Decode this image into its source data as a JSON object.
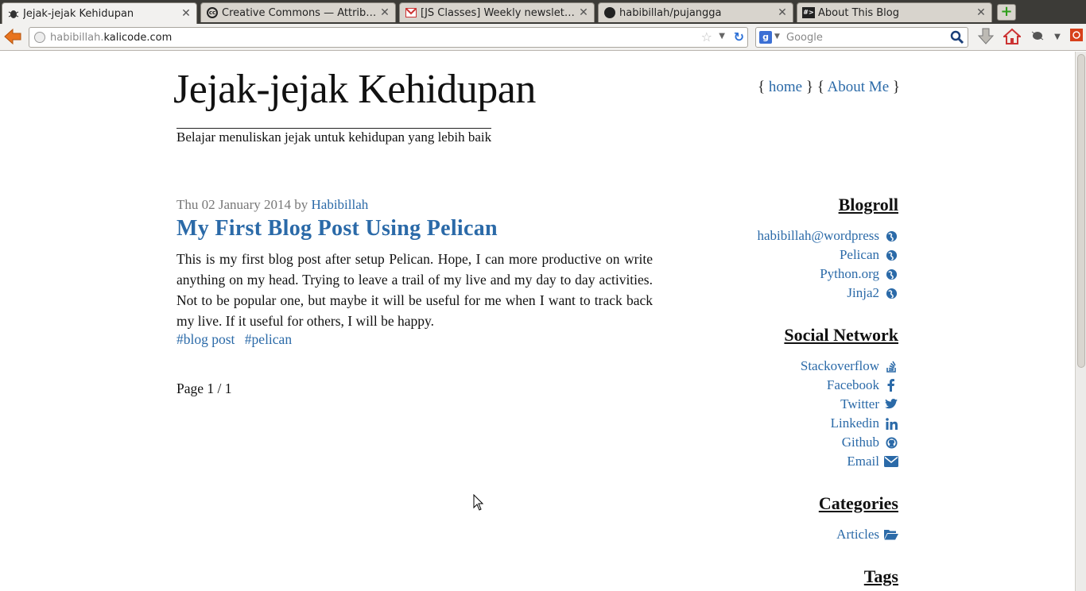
{
  "browser": {
    "tabs": [
      {
        "title": "Jejak-jejak Kehidupan",
        "favicon": "bug-icon",
        "active": true
      },
      {
        "title": "Creative Commons — Attributio…",
        "favicon": "cc-icon",
        "active": false
      },
      {
        "title": "[JS Classes] Weekly newsletter …",
        "favicon": "gmail-icon",
        "active": false
      },
      {
        "title": "habibillah/pujangga",
        "favicon": "github-icon",
        "active": false
      },
      {
        "title": "About This Blog",
        "favicon": "terminal-icon",
        "active": false
      }
    ],
    "url_prefix": "habibillah.",
    "url_domain": "kalicode.com",
    "search_placeholder": "Google"
  },
  "site": {
    "title": "Jejak-jejak Kehidupan",
    "tagline": "Belajar menuliskan jejak untuk kehidupan yang lebih baik",
    "nav": {
      "open1": "{",
      "home": "home",
      "close1": "}",
      "open2": "{",
      "about": "About Me",
      "close2": "}"
    }
  },
  "post": {
    "date": "Thu 02 January 2014",
    "by": "by",
    "author": "Habibillah",
    "title": "My First Blog Post Using Pelican",
    "body": "This is my first blog post after setup Pelican. Hope, I can more productive on write anything on my head. Trying to leave a trail of my live and my day to day activities. Not to be popular one, but maybe it will be useful for me when I want to track back my live. If it useful for others, I will be happy.",
    "tags": [
      "#blog post",
      "#pelican"
    ]
  },
  "pager": "Page 1 / 1",
  "sidebar": {
    "blogroll": {
      "heading": "Blogroll",
      "items": [
        {
          "label": "habibillah@wordpress",
          "icon": "globe-icon"
        },
        {
          "label": "Pelican",
          "icon": "globe-icon"
        },
        {
          "label": "Python.org",
          "icon": "globe-icon"
        },
        {
          "label": "Jinja2",
          "icon": "globe-icon"
        }
      ]
    },
    "social": {
      "heading": "Social Network",
      "items": [
        {
          "label": "Stackoverflow",
          "icon": "stackoverflow-icon"
        },
        {
          "label": "Facebook",
          "icon": "facebook-icon"
        },
        {
          "label": "Twitter",
          "icon": "twitter-icon"
        },
        {
          "label": "Linkedin",
          "icon": "linkedin-icon"
        },
        {
          "label": "Github",
          "icon": "github-icon"
        },
        {
          "label": "Email",
          "icon": "envelope-icon"
        }
      ]
    },
    "categories": {
      "heading": "Categories",
      "items": [
        {
          "label": "Articles",
          "icon": "folder-open-icon"
        }
      ]
    },
    "tags_heading": "Tags"
  },
  "colors": {
    "link": "#2b6aa8",
    "text": "#111111",
    "meta": "#777777"
  }
}
